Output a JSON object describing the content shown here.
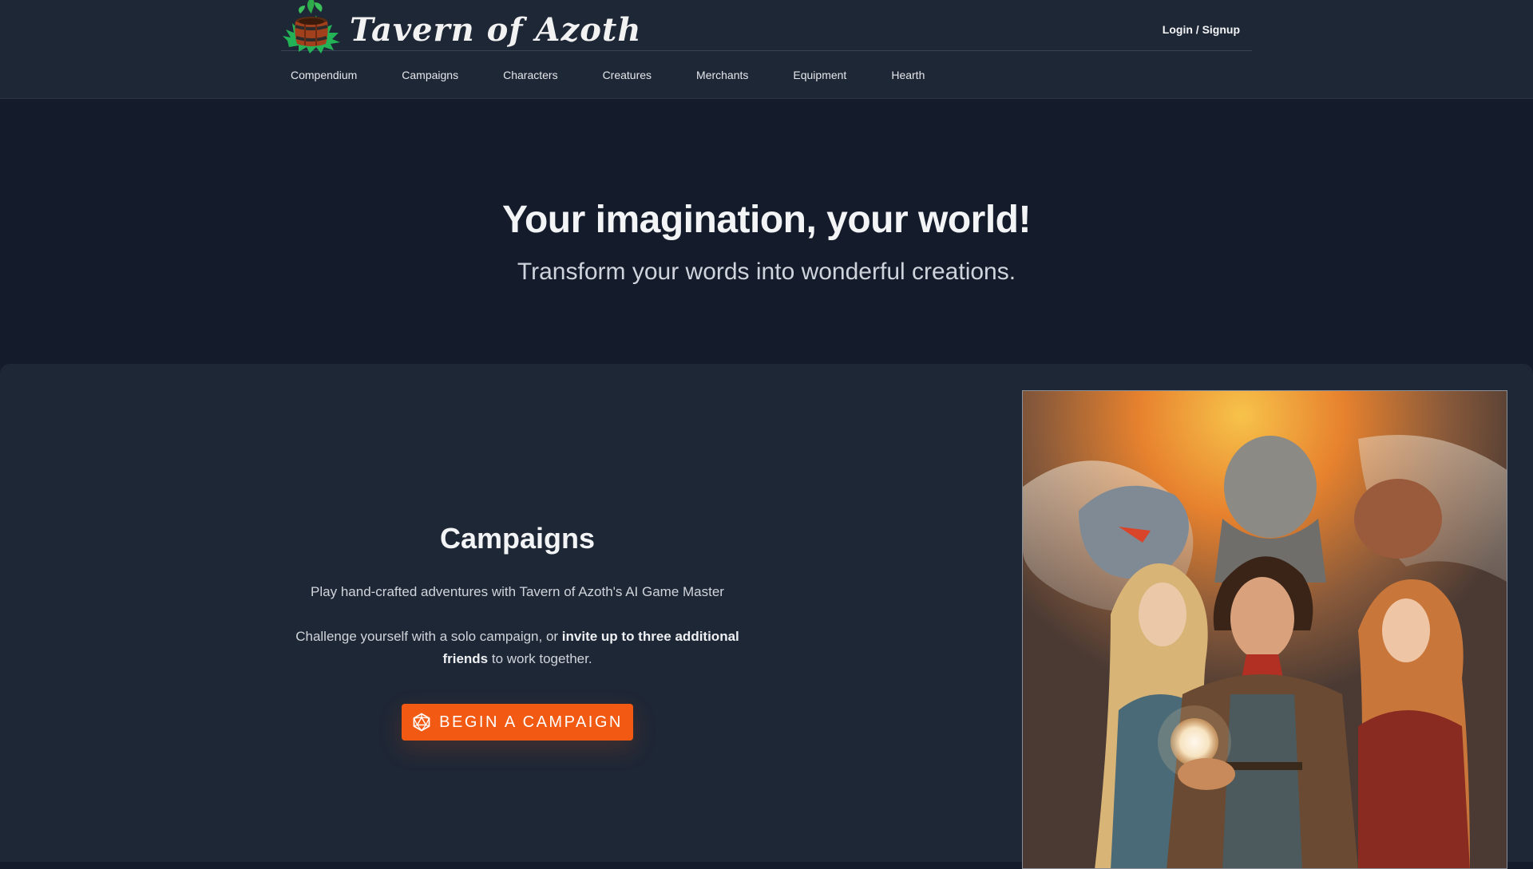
{
  "header": {
    "brand": "Tavern of Azoth",
    "login_label": "Login / Signup",
    "nav": [
      {
        "label": "Compendium"
      },
      {
        "label": "Campaigns"
      },
      {
        "label": "Characters"
      },
      {
        "label": "Creatures"
      },
      {
        "label": "Merchants"
      },
      {
        "label": "Equipment"
      },
      {
        "label": "Hearth"
      }
    ]
  },
  "hero": {
    "title": "Your imagination, your world!",
    "subtitle": "Transform your words into wonderful creations."
  },
  "feature": {
    "title": "Campaigns",
    "paragraph1": "Play hand-crafted adventures with Tavern of Azoth's AI Game Master",
    "paragraph2_pre": "Challenge yourself with a solo campaign, or ",
    "paragraph2_bold": "invite up to three additional friends",
    "paragraph2_post": " to work together.",
    "cta_label": "BEGIN A CAMPAIGN",
    "cta_icon": "d20-dice-icon",
    "artwork": "fantasy-adventurer-party-illustration"
  },
  "colors": {
    "header_bg": "#1e2736",
    "page_bg": "#141b2b",
    "accent": "#f25a13"
  }
}
